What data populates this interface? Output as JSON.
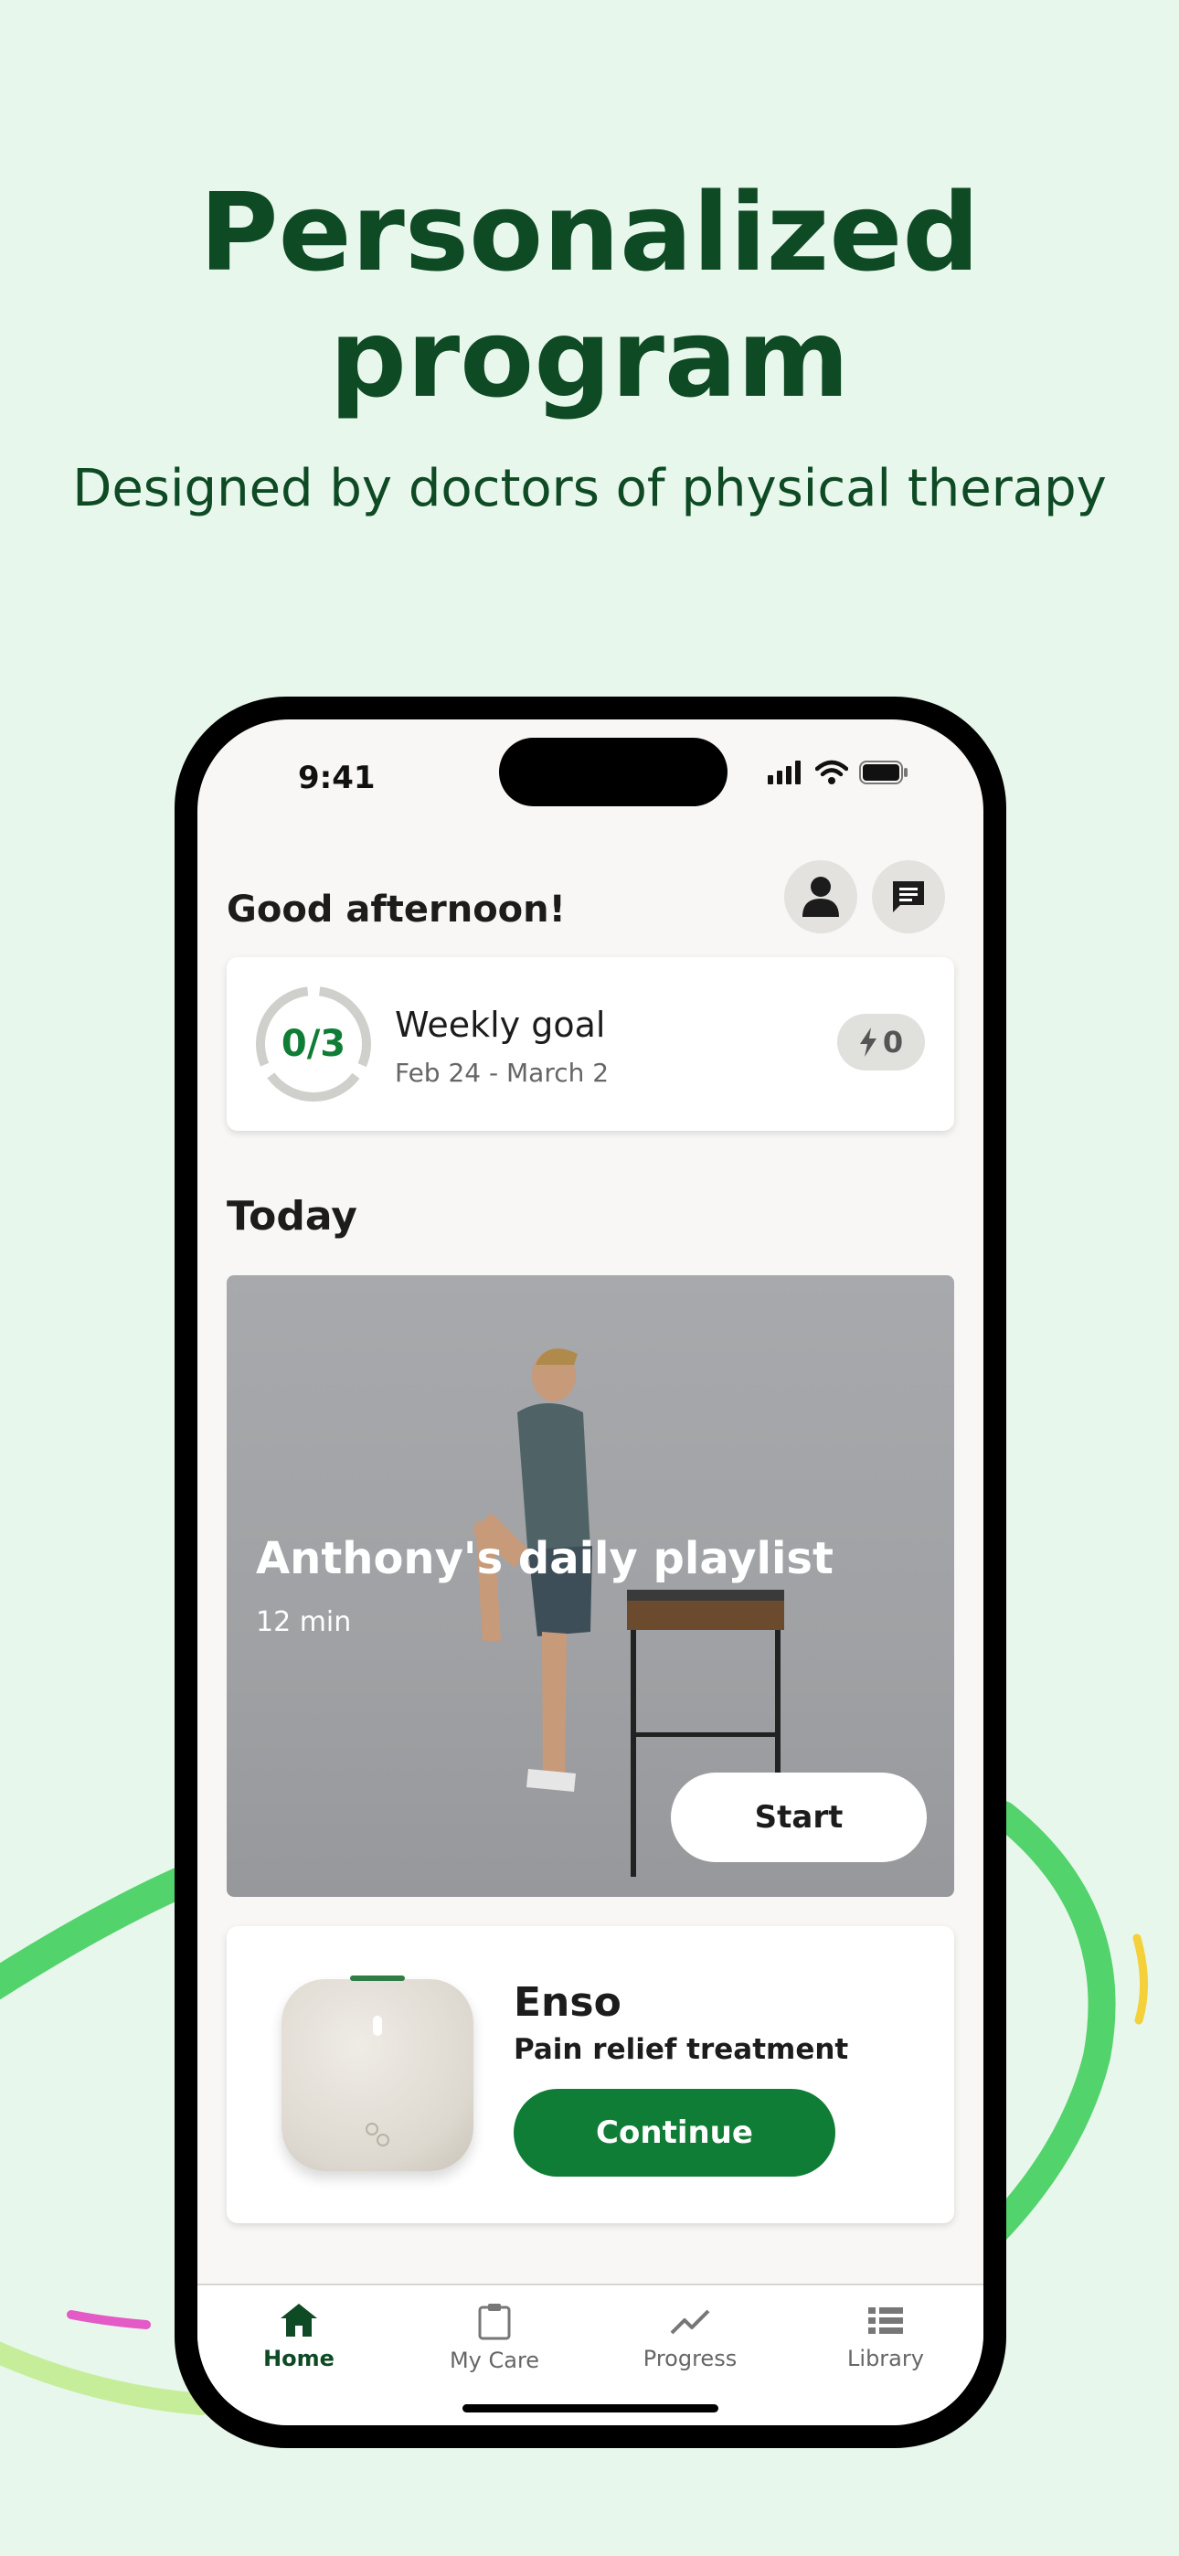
{
  "headline": {
    "line1": "Personalized",
    "line2": "program"
  },
  "subheadline": "Designed by doctors of physical therapy",
  "status_bar": {
    "time": "9:41"
  },
  "home": {
    "greeting": "Good afternoon!",
    "weekly_goal": {
      "progress": "0/3",
      "progress_fraction": 0,
      "title": "Weekly goal",
      "date_range": "Feb 24 - March 2",
      "streak_count": "0"
    },
    "today_heading": "Today",
    "playlist": {
      "title": "Anthony's daily playlist",
      "duration": "12 min",
      "start_label": "Start"
    },
    "enso": {
      "name": "Enso",
      "subtitle": "Pain relief treatment",
      "continue_label": "Continue"
    }
  },
  "tabs": [
    {
      "label": "Home",
      "icon": "home-icon",
      "active": true
    },
    {
      "label": "My Care",
      "icon": "clipboard-icon",
      "active": false
    },
    {
      "label": "Progress",
      "icon": "trend-icon",
      "active": false
    },
    {
      "label": "Library",
      "icon": "list-icon",
      "active": false
    }
  ],
  "colors": {
    "brand_green": "#0f7d35",
    "headline_green": "#0e4a24",
    "background": "#e8f7ec"
  }
}
